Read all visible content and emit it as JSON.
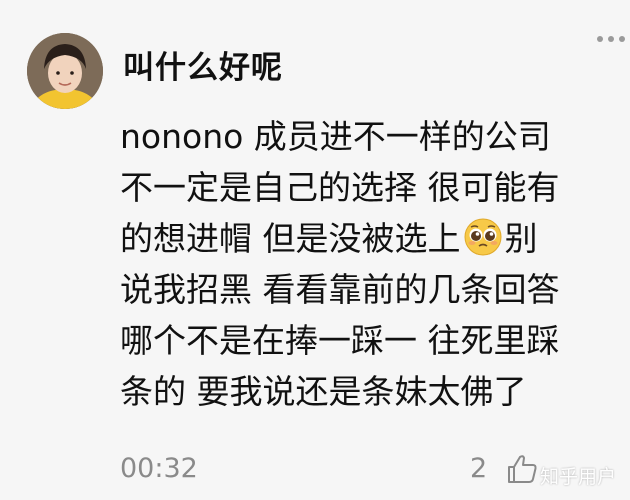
{
  "comment": {
    "username": "叫什么好呢",
    "lines": [
      "nonono 成员进不一样的公司",
      "不一定是自己的选择 很可能有",
      "的想进帽 但是没被选上",
      "别",
      "说我招黑 看看靠前的几条回答",
      "哪个不是在捧一踩一 往死里踩",
      "条的 要我说还是条妹太佛了"
    ],
    "emoji": "pleading-face-emoji",
    "timestamp": "00:32",
    "like_count": "2"
  },
  "watermark": "知乎用户",
  "colors": {
    "background": "#f6f6f6",
    "text": "#111111",
    "meta_text": "#8a8a8a",
    "avatar_shirt": "#f2c430"
  },
  "icons": {
    "more": "more-dots-icon",
    "like": "thumbs-up-icon"
  }
}
